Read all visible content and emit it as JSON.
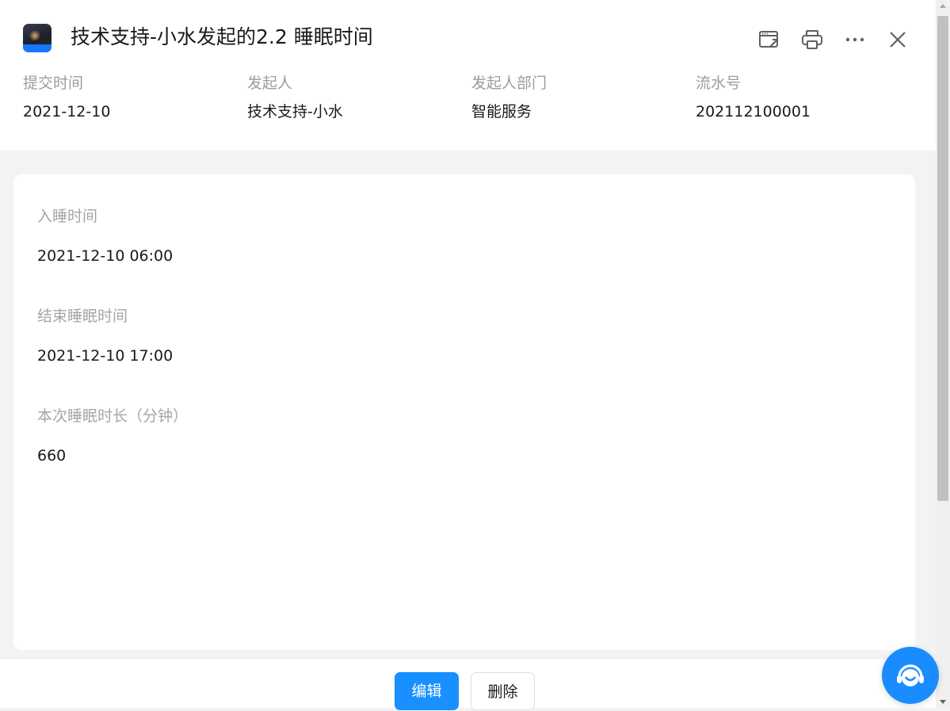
{
  "header": {
    "title": "技术支持-小水发起的2.2 睡眠时间",
    "avatar_icon": "app-avatar-icon",
    "toolbar": [
      {
        "icon": "open-in-window-icon"
      },
      {
        "icon": "printer-icon"
      },
      {
        "icon": "more-icon"
      },
      {
        "icon": "close-icon"
      }
    ]
  },
  "meta": {
    "submit_time": {
      "label": "提交时间",
      "value": "2021-12-10"
    },
    "initiator": {
      "label": "发起人",
      "value": "技术支持-小水"
    },
    "department": {
      "label": "发起人部门",
      "value": "智能服务"
    },
    "serial_no": {
      "label": "流水号",
      "value": "202112100001"
    }
  },
  "form": {
    "fields": [
      {
        "label": "入睡时间",
        "value": "2021-12-10 06:00"
      },
      {
        "label": "结束睡眠时间",
        "value": "2021-12-10 17:00"
      },
      {
        "label": "本次睡眠时长（分钟）",
        "value": "660"
      }
    ]
  },
  "footer": {
    "edit_label": "编辑",
    "delete_label": "删除"
  },
  "colors": {
    "primary": "#1890ff",
    "label_gray": "#9a9ca3",
    "background": "#f2f3f5"
  }
}
